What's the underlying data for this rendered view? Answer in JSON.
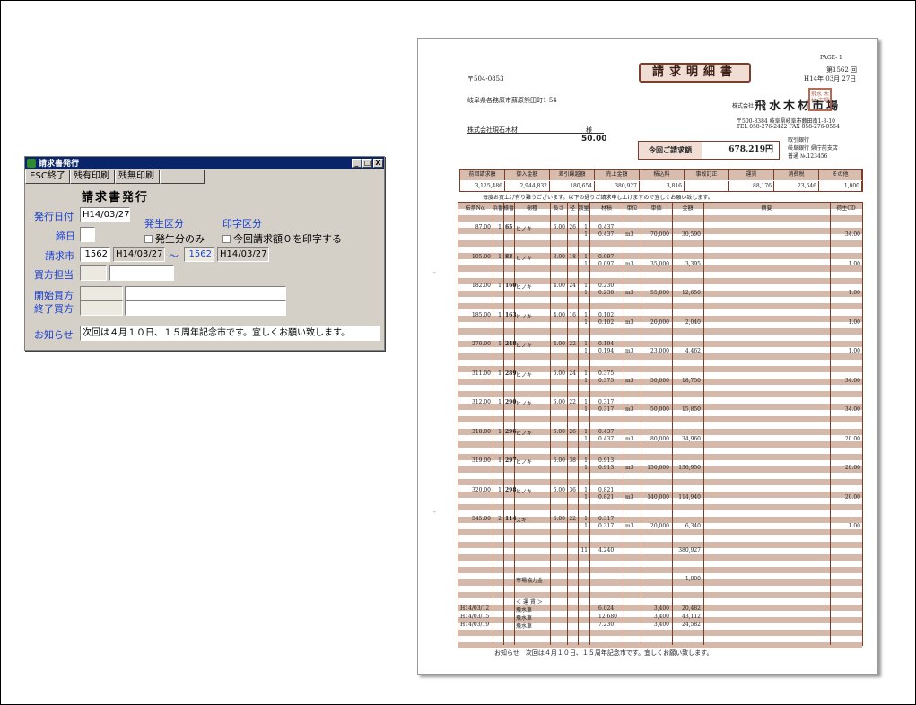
{
  "window": {
    "title": "請求書発行",
    "controls": [
      "_",
      "□",
      "X"
    ],
    "toolbar": [
      "ESC終了",
      "残有印刷",
      "残無印刷",
      ""
    ],
    "form_title": "請求書発行",
    "issue_date_label": "発行日付",
    "issue_date": "H14/03/27",
    "closing_day_label": "締日",
    "closing_day": "",
    "occurrence_label": "発生区分",
    "occurrence_option": "発生分のみ",
    "print_label": "印字区分",
    "print_option": "今回請求額０を印字する",
    "market_label": "請求市",
    "market_from_no": "1562",
    "market_from_date": "H14/03/27",
    "range_sep": "〜",
    "market_to_no": "1562",
    "market_to_date": "H14/03/27",
    "buyer_staff_label": "買方担当",
    "buyer_start_label": "開始買方",
    "buyer_end_label": "終了買方",
    "notice_label": "お知らせ",
    "notice_text": "次回は４月１０日、１５周年記念市です。宜しくお願い致します。"
  },
  "invoice": {
    "page": "PAGE-  1",
    "title": "請求明細書",
    "issue_no": "第1562 回",
    "issue_date": "H14年 03月 27日",
    "zip": "〒504-0853",
    "address": "岐阜県各務原市蘇原熊田町1-54",
    "customer": "株式会社現石木材",
    "honorific": "様",
    "customer_value": "50.00",
    "company_prefix": "株式会社",
    "company": "飛水木材市場",
    "company_zip_addr": "〒500-8384 岐阜県岐阜市薮田南1-3-10",
    "company_tel": "TEL 058-276-2422   FAX 058-276-0564",
    "bank_label": "取引銀行",
    "bank": "岐阜銀行 県庁前支店",
    "account": "普通 №.123456",
    "stamp": "飛水 木材 市場",
    "due_label": "今回ご請求額",
    "due_amount": "678,219円",
    "totals_headers": [
      "前回請求額",
      "御入金額",
      "差引繰越額",
      "売上金額",
      "積込料",
      "事故訂正",
      "運賃",
      "消費税",
      "その他"
    ],
    "totals_values": [
      "3,125,486",
      "2,944,832",
      "180,654",
      "380,927",
      "3,816",
      "",
      "88,176",
      "23,646",
      "1,000"
    ],
    "greeting": "毎度お買上げ有り難うございます。以下の通りご請求申し上げますので宜しくお願い致します。",
    "detail_headers": [
      "伝票No.",
      "浜番",
      "様番",
      "樹種",
      "長さ",
      "径",
      "数量",
      "材積",
      "単位",
      "単価",
      "金額",
      "摘要",
      "荷主CD"
    ],
    "rows": [
      {
        "no": "87.00",
        "hama": "1",
        "ban": "65",
        "species": "ヒノキ",
        "len": "6.00",
        "dia": "26",
        "qty": "1",
        "vol": "0.437",
        "unit": "m3",
        "price": "70,000",
        "amount": "30,590",
        "cd": "34.00"
      },
      {
        "no": "105.00",
        "hama": "1",
        "ban": "83",
        "species": "ヒノキ",
        "len": "3.00",
        "dia": "18",
        "qty": "1",
        "vol": "0.097",
        "unit": "m3",
        "price": "35,000",
        "amount": "3,395",
        "cd": "1.00"
      },
      {
        "no": "182.00",
        "hama": "1",
        "ban": "160",
        "species": "ヒノキ",
        "len": "4.00",
        "dia": "24",
        "qty": "1",
        "vol": "0.230",
        "unit": "m3",
        "price": "55,000",
        "amount": "12,650",
        "cd": "1.00"
      },
      {
        "no": "185.00",
        "hama": "1",
        "ban": "163",
        "species": "ヒノキ",
        "len": "4.00",
        "dia": "16",
        "qty": "1",
        "vol": "0.102",
        "unit": "m3",
        "price": "20,000",
        "amount": "2,040",
        "cd": "1.00"
      },
      {
        "no": "270.00",
        "hama": "1",
        "ban": "248",
        "species": "ヒノキ",
        "len": "4.00",
        "dia": "22",
        "qty": "1",
        "vol": "0.194",
        "unit": "m3",
        "price": "23,000",
        "amount": "4,462",
        "cd": "1.00"
      },
      {
        "no": "311.00",
        "hama": "1",
        "ban": "289",
        "species": "ヒノキ",
        "len": "6.00",
        "dia": "24",
        "qty": "1",
        "vol": "0.375",
        "unit": "m3",
        "price": "50,000",
        "amount": "18,750",
        "cd": "34.00"
      },
      {
        "no": "312.00",
        "hama": "1",
        "ban": "290",
        "species": "ヒノキ",
        "len": "6.00",
        "dia": "22",
        "qty": "1",
        "vol": "0.317",
        "unit": "m3",
        "price": "50,000",
        "amount": "15,850",
        "cd": "34.00"
      },
      {
        "no": "318.00",
        "hama": "1",
        "ban": "296",
        "species": "ヒノキ",
        "len": "6.00",
        "dia": "26",
        "qty": "1",
        "vol": "0.437",
        "unit": "m3",
        "price": "80,000",
        "amount": "34,960",
        "cd": "20.00"
      },
      {
        "no": "319.00",
        "hama": "1",
        "ban": "297",
        "species": "ヒノキ",
        "len": "6.00",
        "dia": "38",
        "qty": "1",
        "vol": "0.913",
        "unit": "m3",
        "price": "150,000",
        "amount": "136,950",
        "cd": "20.00"
      },
      {
        "no": "320.00",
        "hama": "1",
        "ban": "298",
        "species": "ヒノキ",
        "len": "6.00",
        "dia": "36",
        "qty": "1",
        "vol": "0.821",
        "unit": "m3",
        "price": "140,000",
        "amount": "114,940",
        "cd": "20.00"
      },
      {
        "no": "545.00",
        "hama": "2",
        "ban": "114",
        "species": "スギ",
        "len": "6.00",
        "dia": "22",
        "qty": "1",
        "vol": "0.317",
        "unit": "m3",
        "price": "20,000",
        "amount": "6,340",
        "cd": "1.00"
      }
    ],
    "sum_qty": "11",
    "sum_vol": "4.240",
    "sum_amount": "380,927",
    "assoc_label": "市場協力金",
    "assoc_amount": "1,000",
    "freight_title": "＜ 運 賃 ＞",
    "freight": [
      {
        "date": "H14/03/12",
        "name": "飛水車",
        "vol": "6.024",
        "price": "3,400",
        "amount": "20,482"
      },
      {
        "date": "H14/03/15",
        "name": "飛水車",
        "vol": "12.680",
        "price": "3,400",
        "amount": "43,112"
      },
      {
        "date": "H14/03/19",
        "name": "飛水車",
        "vol": "7.230",
        "price": "3,400",
        "amount": "24,582"
      }
    ],
    "footer_label": "お知らせ",
    "footer_text": "次回は４月１０日、１５周年記念市です。宜しくお願い致します。"
  }
}
